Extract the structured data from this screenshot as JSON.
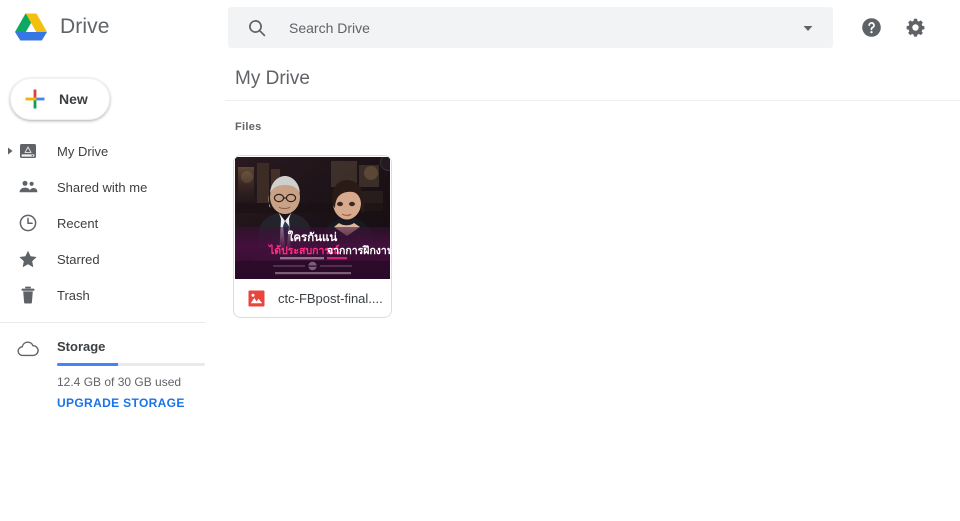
{
  "app": {
    "brand_name": "Drive",
    "logo_icon": "drive-triangle-logo",
    "colors": {
      "drive_green": "#0da960",
      "drive_yellow": "#f4c010",
      "drive_blue": "#3777e3",
      "accent_blue": "#4285f4",
      "link_blue": "#1a73e8",
      "text_primary": "#3c4043",
      "text_secondary": "#5f6368",
      "search_bg": "#f1f3f4",
      "image_file_red": "#e8453c"
    }
  },
  "sidebar": {
    "new_button": {
      "label": "New",
      "icon": "google-plus-icon"
    },
    "items": [
      {
        "label": "My Drive",
        "icon": "my-drive-icon",
        "caret": "expand-caret-icon",
        "expandable": true
      },
      {
        "label": "Shared with me",
        "icon": "people-icon",
        "expandable": false
      },
      {
        "label": "Recent",
        "icon": "clock-icon",
        "expandable": false
      },
      {
        "label": "Starred",
        "icon": "star-icon",
        "expandable": false
      },
      {
        "label": "Trash",
        "icon": "trash-icon",
        "expandable": false
      }
    ],
    "storage": {
      "icon": "cloud-icon",
      "title": "Storage",
      "used_text": "12.4 GB of 30 GB used",
      "used_percent": 41,
      "upgrade_label": "UPGRADE STORAGE"
    }
  },
  "topbar": {
    "search": {
      "icon": "search-icon",
      "placeholder": "Search Drive",
      "value": "",
      "dropdown_icon": "chevron-down-icon"
    },
    "help_icon": "help-circle-icon",
    "settings_icon": "gear-icon"
  },
  "main": {
    "page_title": "My Drive",
    "section_label": "Files",
    "files": [
      {
        "name": "ctc-FBpost-final....",
        "type_icon": "image-file-icon",
        "thumbnail": {
          "description": "movie-still-two-people-at-desk",
          "overlay_line1": "ใครกันแน่",
          "overlay_line2_highlight": "ได้ประสบการณ์",
          "overlay_line2_rest": "จากการฝึกงาน",
          "overlay_subtitle": "Experience never gets old  -  The Intern",
          "overlay_caption": "MAY THE QUOTE BE WITH YOU",
          "highlight_color": "#ff2d84"
        }
      }
    ]
  }
}
